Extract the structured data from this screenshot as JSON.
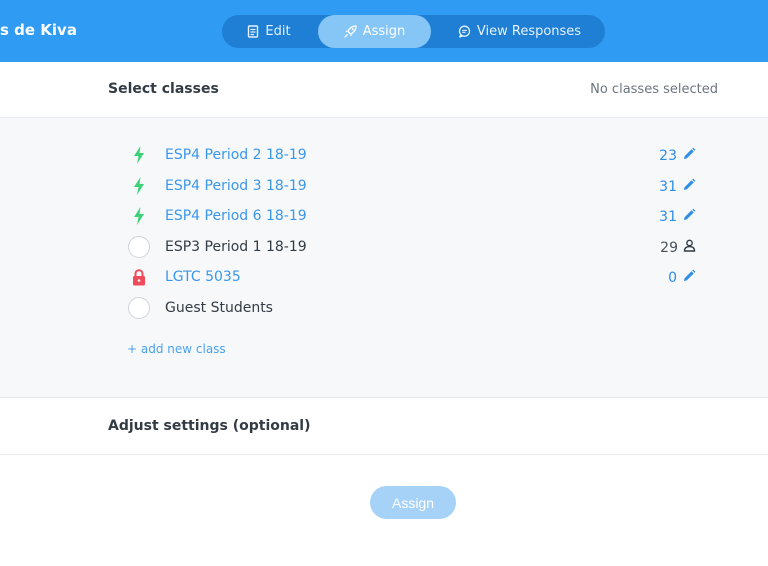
{
  "header": {
    "title": "s de Kiva",
    "tabs": [
      {
        "label": "Edit",
        "icon": "document-icon"
      },
      {
        "label": "Assign",
        "icon": "rocket-icon",
        "active": true
      },
      {
        "label": "View Responses",
        "icon": "chat-bubble-icon"
      }
    ]
  },
  "select_classes": {
    "title": "Select classes",
    "status": "No classes selected"
  },
  "classes": [
    {
      "name": "ESP4 Period 2 18-19",
      "count": "23",
      "status_icon": "lightning-icon",
      "action_icon": "pencil-icon"
    },
    {
      "name": "ESP4 Period 3 18-19",
      "count": "31",
      "status_icon": "lightning-icon",
      "action_icon": "pencil-icon"
    },
    {
      "name": "ESP4 Period 6 18-19",
      "count": "31",
      "status_icon": "lightning-icon",
      "action_icon": "pencil-icon"
    },
    {
      "name": "ESP3 Period 1 18-19",
      "count": "29",
      "status_icon": "empty-circle",
      "action_icon": "person-icon"
    },
    {
      "name": "LGTC 5035",
      "count": "0",
      "status_icon": "lock-icon",
      "action_icon": "pencil-icon"
    },
    {
      "name": "Guest Students",
      "count": "",
      "status_icon": "empty-circle",
      "action_icon": ""
    }
  ],
  "add_class_label": "+ add new class",
  "adjust_settings": {
    "title": "Adjust settings (optional)"
  },
  "assign_button_label": "Assign",
  "colors": {
    "header_bg": "#2f9bf2",
    "tab_track": "#1f7fd4",
    "tab_active": "#86c6f6",
    "link": "#3b97ea",
    "lightning": "#3dd27a",
    "lock": "#ef4b5a",
    "assign_button": "#a6d2f7"
  }
}
